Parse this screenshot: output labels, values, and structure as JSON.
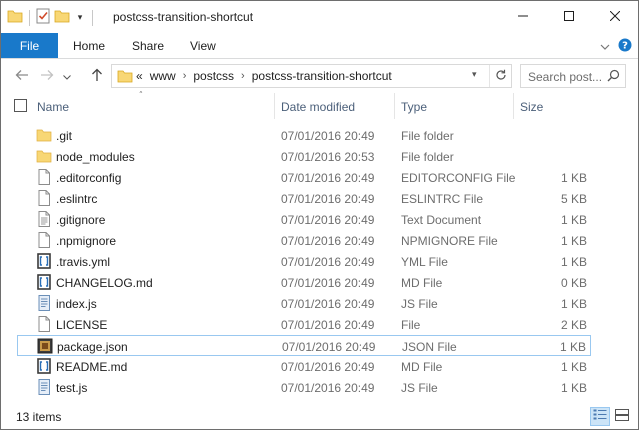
{
  "window": {
    "title": "postcss-transition-shortcut"
  },
  "ribbon": {
    "file": "File",
    "tabs": [
      "Home",
      "Share",
      "View"
    ]
  },
  "address": {
    "prefix": "«",
    "crumbs": [
      "www",
      "postcss",
      "postcss-transition-shortcut"
    ]
  },
  "search": {
    "placeholder": "Search post..."
  },
  "columns": {
    "name": "Name",
    "date": "Date modified",
    "type": "Type",
    "size": "Size"
  },
  "files": [
    {
      "name": ".git",
      "date": "07/01/2016 20:49",
      "type": "File folder",
      "size": "",
      "icon": "folder-icon"
    },
    {
      "name": "node_modules",
      "date": "07/01/2016 20:53",
      "type": "File folder",
      "size": "",
      "icon": "folder-icon"
    },
    {
      "name": ".editorconfig",
      "date": "07/01/2016 20:49",
      "type": "EDITORCONFIG File",
      "size": "1 KB",
      "icon": "blank-file-icon"
    },
    {
      "name": ".eslintrc",
      "date": "07/01/2016 20:49",
      "type": "ESLINTRC File",
      "size": "5 KB",
      "icon": "blank-file-icon"
    },
    {
      "name": ".gitignore",
      "date": "07/01/2016 20:49",
      "type": "Text Document",
      "size": "1 KB",
      "icon": "text-file-icon"
    },
    {
      "name": ".npmignore",
      "date": "07/01/2016 20:49",
      "type": "NPMIGNORE File",
      "size": "1 KB",
      "icon": "blank-file-icon"
    },
    {
      "name": ".travis.yml",
      "date": "07/01/2016 20:49",
      "type": "YML File",
      "size": "1 KB",
      "icon": "bracket-file-icon"
    },
    {
      "name": "CHANGELOG.md",
      "date": "07/01/2016 20:49",
      "type": "MD File",
      "size": "0 KB",
      "icon": "bracket-file-icon"
    },
    {
      "name": "index.js",
      "date": "07/01/2016 20:49",
      "type": "JS File",
      "size": "1 KB",
      "icon": "script-file-icon"
    },
    {
      "name": "LICENSE",
      "date": "07/01/2016 20:49",
      "type": "File",
      "size": "2 KB",
      "icon": "blank-file-icon"
    },
    {
      "name": "package.json",
      "date": "07/01/2016 20:49",
      "type": "JSON File",
      "size": "1 KB",
      "icon": "json-file-icon",
      "selected": true
    },
    {
      "name": "README.md",
      "date": "07/01/2016 20:49",
      "type": "MD File",
      "size": "1 KB",
      "icon": "bracket-file-icon"
    },
    {
      "name": "test.js",
      "date": "07/01/2016 20:49",
      "type": "JS File",
      "size": "1 KB",
      "icon": "script-file-icon"
    }
  ],
  "status": {
    "count": "13 items"
  },
  "colors": {
    "accent": "#1979ca",
    "folder": "#f8d775",
    "selection_border": "#99c8f0"
  }
}
